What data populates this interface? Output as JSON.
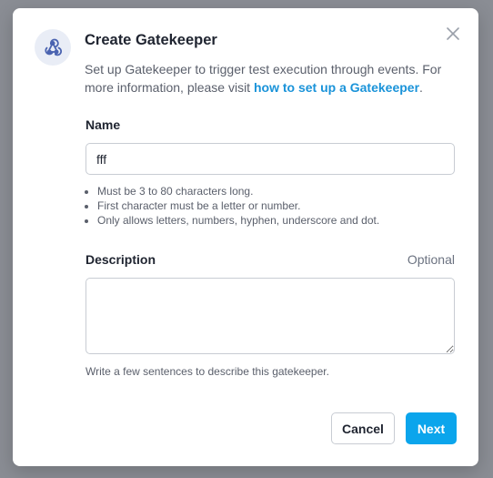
{
  "modal": {
    "title": "Create Gatekeeper",
    "subtitle_prefix": "Set up Gatekeeper to trigger test execution through events. For more information, please visit ",
    "subtitle_link": "how to set up a Gatekeeper",
    "subtitle_suffix": ".",
    "header_icon": "webhook-icon",
    "close_icon": "close-icon"
  },
  "name_field": {
    "label": "Name",
    "value": "fff",
    "hints": [
      "Must be 3 to 80 characters long.",
      "First character must be a letter or number.",
      "Only allows letters, numbers, hyphen, underscore and dot."
    ]
  },
  "description_field": {
    "label": "Description",
    "optional_label": "Optional",
    "value": "",
    "helper": "Write a few sentences to describe this gatekeeper."
  },
  "buttons": {
    "cancel": "Cancel",
    "next": "Next"
  },
  "colors": {
    "accent": "#0ba5ec",
    "link": "#1a93d9",
    "icon": "#4a63b0"
  }
}
